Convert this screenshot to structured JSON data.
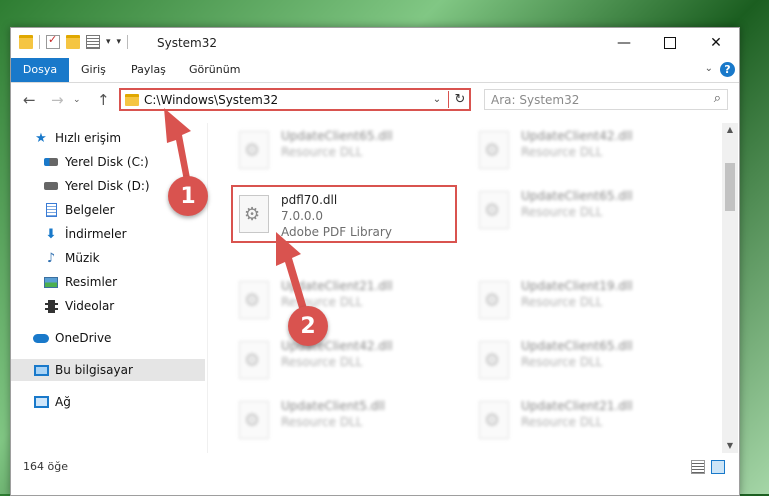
{
  "window": {
    "title": "System32"
  },
  "ribbon": {
    "tabs": [
      "Dosya",
      "Giriş",
      "Paylaş",
      "Görünüm"
    ],
    "help_label": "?"
  },
  "nav": {
    "address": "C:\\Windows\\System32",
    "search_placeholder": "Ara: System32"
  },
  "sidebar": {
    "items": [
      {
        "label": "Hızlı erişim",
        "icon": "star-icon",
        "pinned": false
      },
      {
        "label": "Yerel Disk (C:)",
        "icon": "disk-c-icon",
        "pinned": true
      },
      {
        "label": "Yerel Disk (D:)",
        "icon": "disk-d-icon",
        "pinned": false
      },
      {
        "label": "Belgeler",
        "icon": "documents-icon",
        "pinned": true
      },
      {
        "label": "İndirmeler",
        "icon": "downloads-icon",
        "pinned": true
      },
      {
        "label": "Müzik",
        "icon": "music-icon",
        "pinned": true
      },
      {
        "label": "Resimler",
        "icon": "pictures-icon",
        "pinned": true
      },
      {
        "label": "Videolar",
        "icon": "videos-icon",
        "pinned": true
      },
      {
        "label": "OneDrive",
        "icon": "onedrive-icon",
        "pinned": false
      },
      {
        "label": "Bu bilgisayar",
        "icon": "this-pc-icon",
        "pinned": false,
        "selected": true
      },
      {
        "label": "Ağ",
        "icon": "network-icon",
        "pinned": false
      }
    ]
  },
  "files": {
    "left_column": [
      {
        "name": "UpdateClient65.dll",
        "type": "Resource DLL"
      },
      {
        "name": "pdfl70.dll",
        "version": "7.0.0.0",
        "type": "Adobe PDF Library",
        "highlighted": true
      },
      {
        "name": "UpdateClient21.dll",
        "type": "Resource DLL"
      },
      {
        "name": "UpdateClient42.dll",
        "type": "Resource DLL"
      },
      {
        "name": "UpdateClient5.dll",
        "type": "Resource DLL"
      }
    ],
    "right_column": [
      {
        "name": "UpdateClient42.dll",
        "type": "Resource DLL"
      },
      {
        "name": "UpdateClient65.dll",
        "type": "Resource DLL"
      },
      {
        "name": "UpdateClient19.dll",
        "type": "Resource DLL"
      },
      {
        "name": "UpdateClient65.dll",
        "type": "Resource DLL"
      },
      {
        "name": "UpdateClient21.dll",
        "type": "Resource DLL"
      }
    ]
  },
  "status": {
    "count": "164 öğe"
  },
  "annotations": {
    "step1": "1",
    "step2": "2",
    "color": "#d9534f"
  }
}
